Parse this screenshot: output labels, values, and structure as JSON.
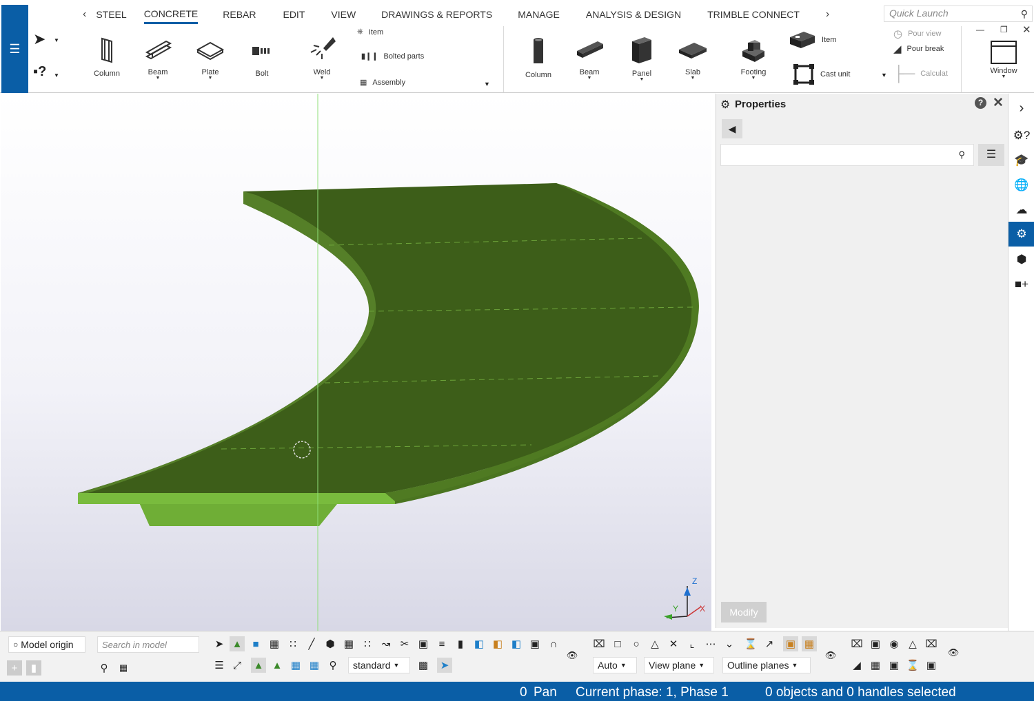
{
  "ribbon": {
    "menu_icon": "hamburger-icon",
    "tabs": [
      "STEEL",
      "CONCRETE",
      "REBAR",
      "EDIT",
      "VIEW",
      "DRAWINGS & REPORTS",
      "MANAGE",
      "ANALYSIS & DESIGN",
      "TRIMBLE CONNECT"
    ],
    "active_tab": "CONCRETE",
    "quick_launch_placeholder": "Quick Launch",
    "steel": {
      "column": "Column",
      "beam": "Beam",
      "plate": "Plate",
      "bolt": "Bolt",
      "weld": "Weld",
      "item": "Item",
      "bolted_parts": "Bolted parts",
      "assembly": "Assembly"
    },
    "concrete": {
      "column": "Column",
      "beam": "Beam",
      "panel": "Panel",
      "slab": "Slab",
      "footing": "Footing",
      "item": "Item",
      "cast_unit": "Cast unit",
      "pour_view": "Pour view",
      "pour_break": "Pour break",
      "calculat": "Calculat"
    },
    "window": "Window"
  },
  "properties": {
    "title": "Properties",
    "search_value": "",
    "modify_label": "Modify"
  },
  "bottom": {
    "model_origin": "Model origin",
    "search_placeholder": "Search in model",
    "standard": "standard",
    "auto": "Auto",
    "view_plane": "View plane",
    "outline_planes": "Outline planes"
  },
  "status": {
    "count": "0",
    "mode": "Pan",
    "phase": "Current phase: 1, Phase 1",
    "selection": "0 objects and 0 handles selected"
  },
  "axis": {
    "x": "X",
    "y": "Y",
    "z": "Z"
  },
  "colors": {
    "accent": "#0a5ea6",
    "slab_top": "#3d5e19",
    "slab_side": "#6fae36"
  }
}
